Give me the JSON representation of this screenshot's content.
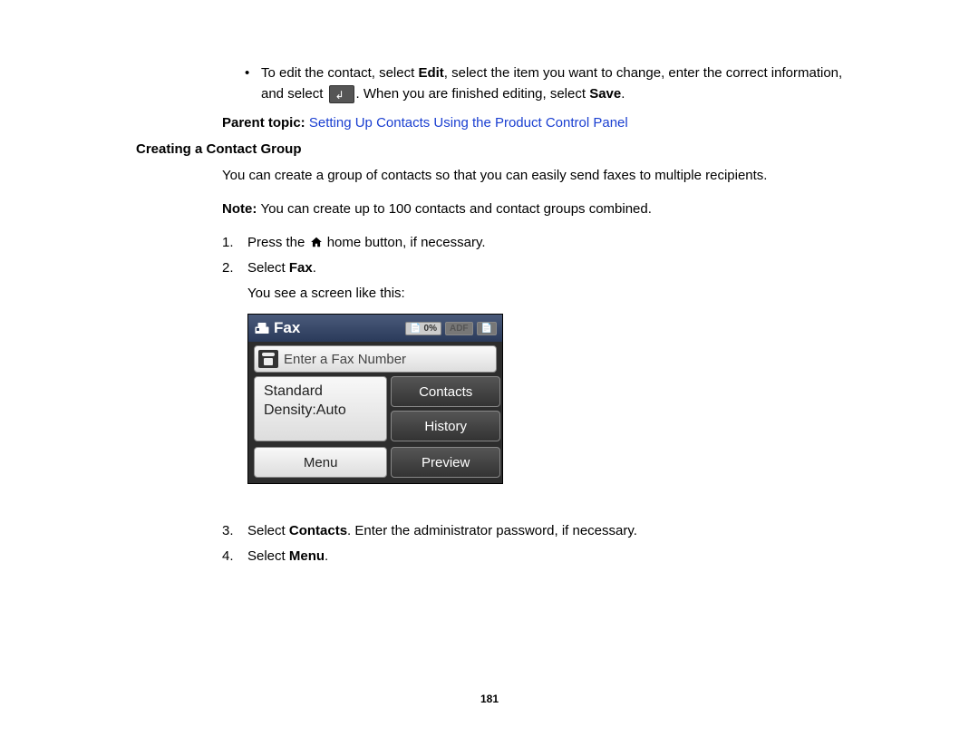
{
  "bullet": {
    "text_before_edit": "To edit the contact, select ",
    "edit": "Edit",
    "text_after_edit": ", select the item you want to change, enter the correct information, and select ",
    "text_after_icon": ". When you are finished editing, select ",
    "save": "Save",
    "period": "."
  },
  "parent_topic": {
    "label": "Parent topic: ",
    "link": "Setting Up Contacts Using the Product Control Panel"
  },
  "heading": "Creating a Contact Group",
  "intro": "You can create a group of contacts so that you can easily send faxes to multiple recipients.",
  "note": {
    "label": "Note: ",
    "text": "You can create up to 100 contacts and contact groups combined."
  },
  "steps": {
    "s1": {
      "num": "1.",
      "before": "Press the ",
      "after": " home button, if necessary."
    },
    "s2": {
      "num": "2.",
      "before": "Select ",
      "bold": "Fax",
      "after": "."
    },
    "s2_sub": "You see a screen like this:",
    "s3": {
      "num": "3.",
      "before": "Select ",
      "bold": "Contacts",
      "after": ". Enter the administrator password, if necessary."
    },
    "s4": {
      "num": "4.",
      "before": "Select ",
      "bold": "Menu",
      "after": "."
    }
  },
  "fax_screen": {
    "title": "Fax",
    "status_badges": [
      "0%",
      "ADF"
    ],
    "number_placeholder": "Enter a Fax Number",
    "left_panel": {
      "line1": "Standard",
      "line2": "Density:Auto"
    },
    "buttons": {
      "contacts": "Contacts",
      "history": "History",
      "menu": "Menu",
      "preview": "Preview"
    }
  },
  "page_number": "181"
}
